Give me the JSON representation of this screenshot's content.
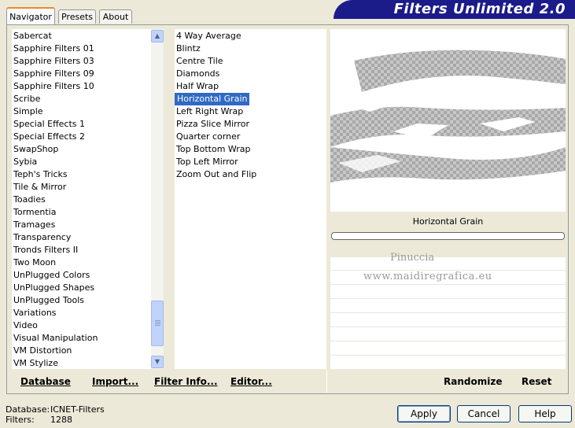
{
  "tabs": [
    {
      "label": "Navigator",
      "active": true
    },
    {
      "label": "Presets",
      "active": false
    },
    {
      "label": "About",
      "active": false
    }
  ],
  "banner": {
    "title": "Filters Unlimited 2.0"
  },
  "categories": [
    "Sabercat",
    "Sapphire Filters 01",
    "Sapphire Filters 03",
    "Sapphire Filters 09",
    "Sapphire Filters 10",
    "Scribe",
    "Simple",
    "Special Effects 1",
    "Special Effects 2",
    "SwapShop",
    "Sybia",
    "Teph's Tricks",
    "Tile & Mirror",
    "Toadies",
    "Tormentia",
    "Tramages",
    "Transparency",
    "Tronds Filters II",
    "Two Moon",
    "UnPlugged Colors",
    "UnPlugged Shapes",
    "UnPlugged Tools",
    "Variations",
    "Video",
    "Visual Manipulation",
    "VM Distortion",
    "VM Stylize"
  ],
  "selected_category": "Simple",
  "filters": [
    "4 Way Average",
    "Blintz",
    "Centre Tile",
    "Diamonds",
    "Half Wrap",
    "Horizontal Grain",
    "Left Right Wrap",
    "Pizza Slice Mirror",
    "Quarter corner",
    "Top Bottom Wrap",
    "Top Left Mirror",
    "Zoom Out and Flip"
  ],
  "selected_filter": "Horizontal Grain",
  "preview": {
    "filter_name": "Horizontal Grain",
    "watermark_line1": "Pinuccia",
    "watermark_line2": "www.maidiregrafica.eu"
  },
  "toolbar": {
    "database": "Database",
    "import": "Import...",
    "filter_info": "Filter Info...",
    "editor": "Editor...",
    "randomize": "Randomize",
    "reset": "Reset"
  },
  "status": {
    "database_label": "Database:",
    "database_value": "ICNET-Filters",
    "filters_label": "Filters:",
    "filters_value": "1288"
  },
  "buttons": {
    "apply": "Apply",
    "cancel": "Cancel",
    "help": "Help"
  },
  "colors": {
    "banner": "#1b1b8a",
    "selection": "#316ac5",
    "scrollbar": "#c1d3fb"
  }
}
